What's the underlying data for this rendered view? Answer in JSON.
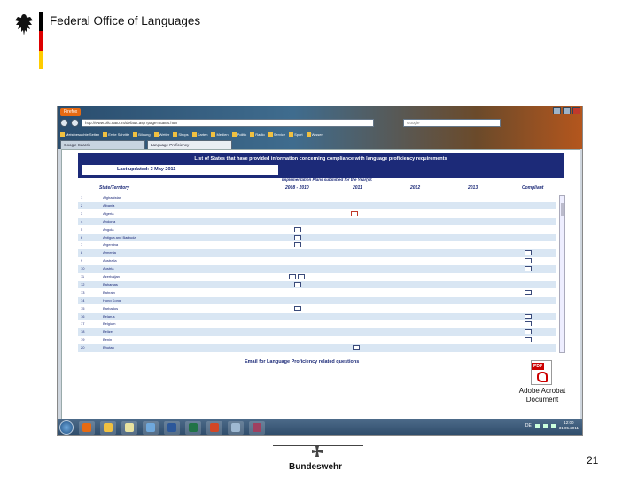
{
  "slide": {
    "agency": "Federal Office of Languages",
    "flag_colors": [
      "#000000",
      "#dd0000",
      "#ffcc00"
    ],
    "footer_brand": "Bundeswehr",
    "page_number": "21"
  },
  "browser": {
    "app_button": "Firefox",
    "url": "http://www.bilc.nato.int/default.asp?page=states.htm",
    "search_placeholder": "Google",
    "bookmarks": [
      "Meistbesuchte Seiten",
      "Erste Schritte",
      "Bildung",
      "Wetter",
      "Shops",
      "Karten",
      "Medien",
      "Politik",
      "Radio",
      "Service",
      "Sport",
      "Wissen"
    ],
    "tabs": [
      "Google Search",
      "Language Proficiency"
    ]
  },
  "page": {
    "title": "List of States that have provided information concerning compliance with language proficiency requirements",
    "last_updated": "Last updated: 3 May 2011",
    "impl_title": "Implementation Plans submitted for the Year(s):",
    "columns": {
      "state": "State/Territory",
      "y2008": "2008 - 2010",
      "y2011": "2011",
      "y2012": "2012",
      "y2013": "2013",
      "compliant": "Compliant"
    },
    "rows": [
      {
        "num": "1",
        "name": "Afghanistan"
      },
      {
        "num": "2",
        "name": "Albania"
      },
      {
        "num": "3",
        "name": "Algeria"
      },
      {
        "num": "4",
        "name": "Andorra"
      },
      {
        "num": "5",
        "name": "Angola"
      },
      {
        "num": "6",
        "name": "Antigua and Barbuda"
      },
      {
        "num": "7",
        "name": "Argentina"
      },
      {
        "num": "8",
        "name": "Armenia"
      },
      {
        "num": "9",
        "name": "Australia"
      },
      {
        "num": "10",
        "name": "Austria"
      },
      {
        "num": "11",
        "name": "Azerbaijan"
      },
      {
        "num": "12",
        "name": "Bahamas"
      },
      {
        "num": "13",
        "name": "Bahrain"
      },
      {
        "num": "14",
        "name": "Hong Kong"
      },
      {
        "num": "15",
        "name": "Barbados"
      },
      {
        "num": "16",
        "name": "Belarus"
      },
      {
        "num": "17",
        "name": "Belgium"
      },
      {
        "num": "18",
        "name": "Belize"
      },
      {
        "num": "19",
        "name": "Benin"
      },
      {
        "num": "20",
        "name": "Bhutan"
      }
    ],
    "email_link": "Email for Language Proficiency related questions"
  },
  "taskbar": {
    "lang": "DE",
    "time": "12:00",
    "date": "31.05.2011"
  },
  "attachment": {
    "tag": "PDF",
    "label_line1": "Adobe Acrobat",
    "label_line2": "Document"
  }
}
